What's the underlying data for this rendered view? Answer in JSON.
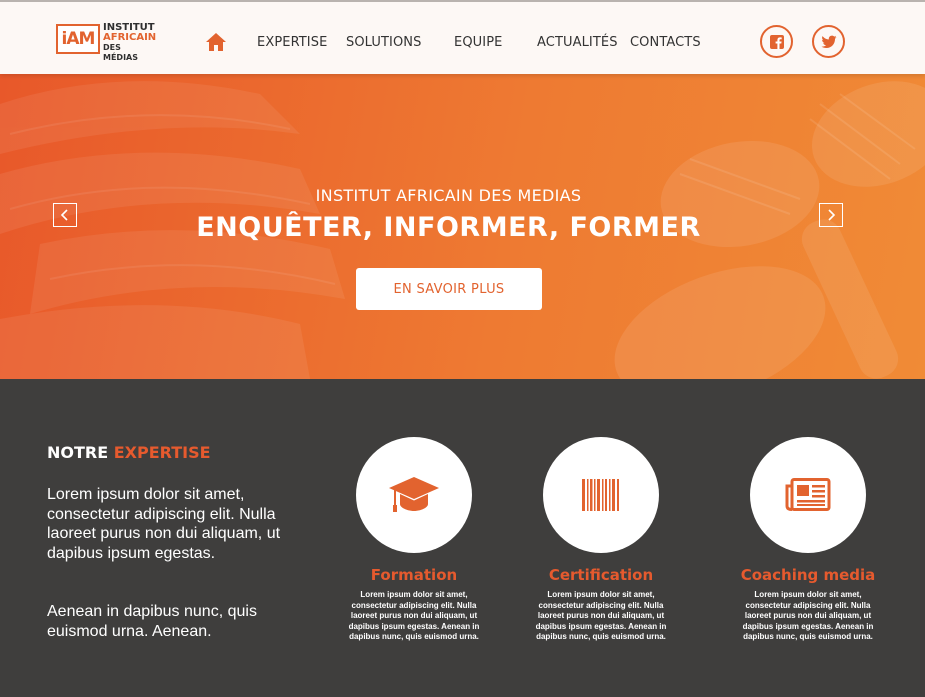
{
  "brand": {
    "logo_mark": "iAM",
    "logo_line1": "INSTITUT",
    "logo_line2": "AFRICAIN",
    "logo_line3": "DES MÉDIAS",
    "accent_color": "#e2632f"
  },
  "nav": {
    "home_icon": "home-icon",
    "items": [
      {
        "label": "EXPERTISE"
      },
      {
        "label": "SOLUTIONS"
      },
      {
        "label": "EQUIPE"
      },
      {
        "label": "ACTUALITÉS"
      },
      {
        "label": "CONTACTS"
      }
    ],
    "social": [
      {
        "icon": "facebook-icon"
      },
      {
        "icon": "twitter-icon"
      }
    ]
  },
  "hero": {
    "subtitle": "INSTITUT AFRICAIN DES MEDIAS",
    "title": "ENQUÊTER, INFORMER, FORMER",
    "button_label": "EN SAVOIR PLUS",
    "prev_icon": "chevron-left-icon",
    "next_icon": "chevron-right-icon"
  },
  "expertise": {
    "title_white": "NOTRE ",
    "title_accent": "EXPERTISE",
    "paragraph1": "Lorem ipsum dolor sit amet, consectetur adipiscing elit. Nulla laoreet purus non dui aliquam, ut dapibus ipsum egestas.",
    "paragraph2": "Aenean in dapibus nunc, quis euismod urna. Aenean.",
    "cards": [
      {
        "icon": "graduation-cap-icon",
        "title": "Formation",
        "text": "Lorem ipsum dolor sit amet, consectetur adipiscing elit. Nulla laoreet purus non dui aliquam, ut dapibus ipsum egestas. Aenean in dapibus nunc, quis euismod urna."
      },
      {
        "icon": "barcode-icon",
        "title": "Certification",
        "text": "Lorem ipsum dolor sit amet, consectetur adipiscing elit. Nulla laoreet purus non dui aliquam, ut dapibus ipsum egestas. Aenean in dapibus nunc, quis euismod urna."
      },
      {
        "icon": "newspaper-icon",
        "title": "Coaching media",
        "text": "Lorem ipsum dolor sit amet, consectetur adipiscing elit. Nulla laoreet purus non dui aliquam, ut dapibus ipsum egestas. Aenean in dapibus nunc, quis euismod urna."
      }
    ]
  }
}
